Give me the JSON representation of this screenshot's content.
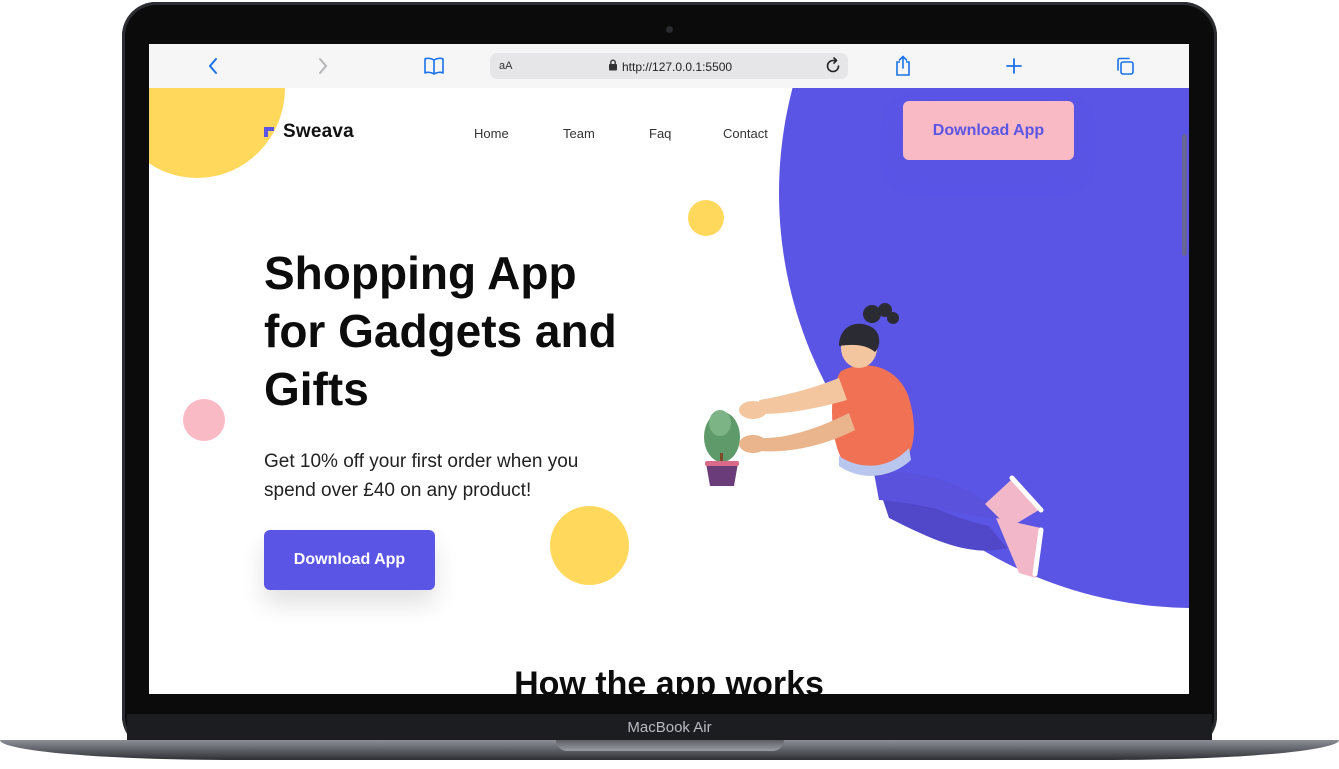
{
  "device": {
    "label": "MacBook Air"
  },
  "browser": {
    "text_size_label": "aA",
    "url": "http://127.0.0.1:5500"
  },
  "site": {
    "logo": "Sweava",
    "nav": [
      "Home",
      "Team",
      "Faq",
      "Contact"
    ],
    "nav_button": "Download App"
  },
  "hero": {
    "title": "Shopping App for Gadgets and Gifts",
    "subtitle": "Get 10% off your first order when you spend over £40 on any product!",
    "button": "Download App"
  },
  "next_section": {
    "title": "How the app works"
  },
  "colors": {
    "accent": "#5b55e6",
    "yellow": "#ffd85c",
    "pink": "#f9b9c5"
  }
}
